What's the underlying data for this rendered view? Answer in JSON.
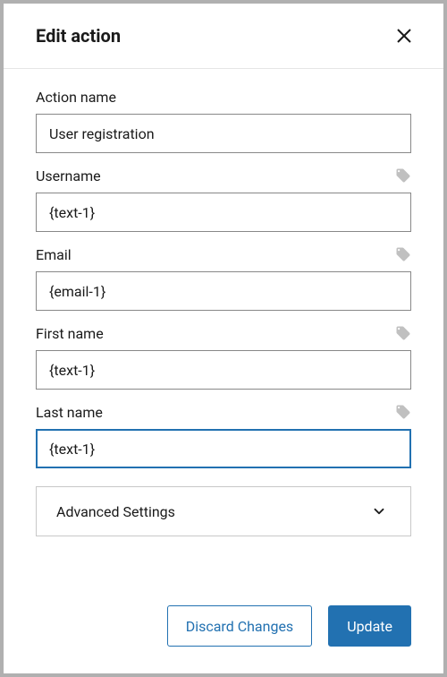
{
  "header": {
    "title": "Edit action"
  },
  "fields": {
    "action_name": {
      "label": "Action name",
      "value": "User registration",
      "has_tag": false
    },
    "username": {
      "label": "Username",
      "value": "{text-1}",
      "has_tag": true
    },
    "email": {
      "label": "Email",
      "value": "{email-1}",
      "has_tag": true
    },
    "first_name": {
      "label": "First name",
      "value": "{text-1}",
      "has_tag": true
    },
    "last_name": {
      "label": "Last name",
      "value": "{text-1}",
      "has_tag": true,
      "focused": true
    }
  },
  "accordion": {
    "label": "Advanced Settings"
  },
  "footer": {
    "discard_label": "Discard Changes",
    "update_label": "Update"
  }
}
